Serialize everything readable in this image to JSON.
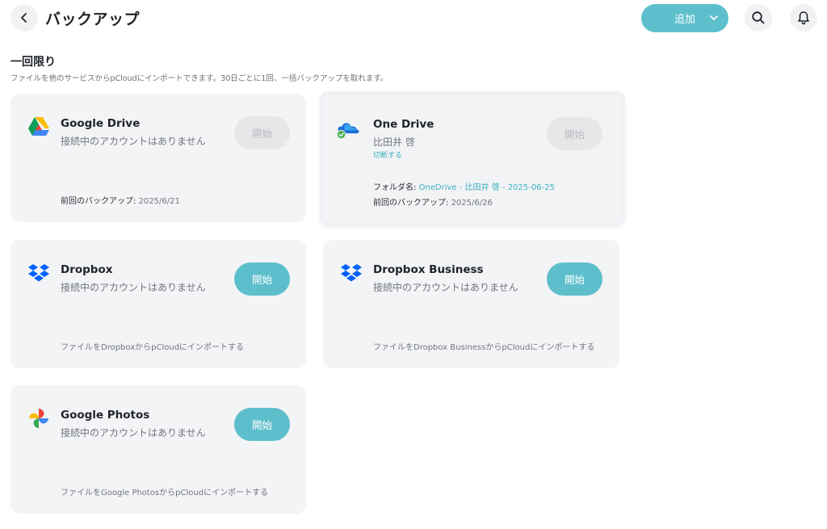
{
  "header": {
    "title": "バックアップ",
    "add_label": "追加"
  },
  "section": {
    "title": "一回限り",
    "subtitle": "ファイルを他のサービスからpCloudにインポートできます。30日ごとに1回、一括バックアップを取れます。"
  },
  "cards": {
    "google_drive": {
      "name": "Google Drive",
      "status": "接続中のアカウントはありません",
      "button": "開始",
      "last_backup_label": "前回のバックアップ:",
      "last_backup_value": "2025/6/21"
    },
    "one_drive": {
      "name": "One Drive",
      "status": "比田井 啓",
      "disconnect": "切断する",
      "button": "開始",
      "folder_label": "フォルダ名:",
      "folder_value": "OneDrive - 比田井 啓 - 2025-06-25",
      "last_backup_label": "前回のバックアップ:",
      "last_backup_value": "2025/6/26"
    },
    "dropbox": {
      "name": "Dropbox",
      "status": "接続中のアカウントはありません",
      "button": "開始",
      "footer": "ファイルをDropboxからpCloudにインポートする"
    },
    "dropbox_business": {
      "name": "Dropbox Business",
      "status": "接続中のアカウントはありません",
      "button": "開始",
      "footer": "ファイルをDropbox BusinessからpCloudにインポートする"
    },
    "google_photos": {
      "name": "Google Photos",
      "status": "接続中のアカウントはありません",
      "button": "開始",
      "footer": "ファイルをGoogle PhotosからpCloudにインポートする"
    }
  },
  "colors": {
    "accent": "#5ebfcc",
    "link": "#3bb0c0",
    "card_bg": "#f3f4f6",
    "disabled_bg": "#e6e7e9"
  },
  "icons": [
    "back-arrow-icon",
    "chevron-down-icon",
    "search-icon",
    "bell-icon",
    "google-drive-icon",
    "onedrive-icon",
    "check-badge-icon",
    "dropbox-icon",
    "google-photos-icon"
  ]
}
